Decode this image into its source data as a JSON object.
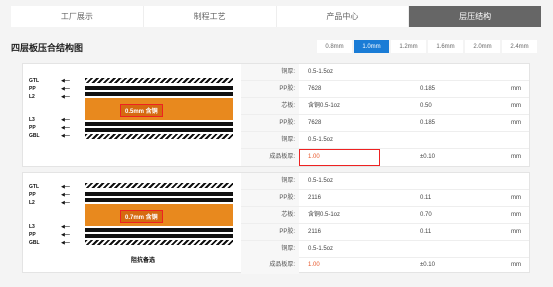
{
  "nav": {
    "tabs": [
      "工厂展示",
      "制程工艺",
      "产品中心",
      "层压结构"
    ]
  },
  "title": "四层板压合结构图",
  "thickness": [
    "0.8mm",
    "1.0mm",
    "1.2mm",
    "1.6mm",
    "2.0mm",
    "2.4mm"
  ],
  "card1": {
    "labels": [
      "GTL",
      "PP",
      "L2",
      "L3",
      "PP",
      "GBL"
    ],
    "core_label": "0.5mm 含铜",
    "rows": [
      {
        "k": "铜厚:",
        "v": "0.5-1.5oz",
        "n": "",
        "u": ""
      },
      {
        "k": "PP胶:",
        "v": "7628",
        "n": "0.185",
        "u": "mm"
      },
      {
        "k": "芯板:",
        "v": "含铜0.5-1oz",
        "n": "0.50",
        "u": "mm"
      },
      {
        "k": "PP胶:",
        "v": "7628",
        "n": "0.185",
        "u": "mm"
      },
      {
        "k": "铜厚:",
        "v": "0.5-1.5oz",
        "n": "",
        "u": ""
      },
      {
        "k": "成品板厚:",
        "v": "1.00",
        "n": "±0.10",
        "u": "mm"
      }
    ]
  },
  "card2": {
    "labels": [
      "GTL",
      "PP",
      "L2",
      "L3",
      "PP",
      "GBL"
    ],
    "core_label": "0.7mm 含铜",
    "caption": "阻抗备选",
    "rows": [
      {
        "k": "铜厚:",
        "v": "0.5-1.5oz",
        "n": "",
        "u": ""
      },
      {
        "k": "PP胶:",
        "v": "2116",
        "n": "0.11",
        "u": "mm"
      },
      {
        "k": "芯板:",
        "v": "含铜0.5-1oz",
        "n": "0.70",
        "u": "mm"
      },
      {
        "k": "PP胶:",
        "v": "2116",
        "n": "0.11",
        "u": "mm"
      },
      {
        "k": "铜厚:",
        "v": "0.5-1.5oz",
        "n": "",
        "u": ""
      },
      {
        "k": "成品板厚:",
        "v": "1.00",
        "n": "±0.10",
        "u": "mm"
      }
    ]
  }
}
